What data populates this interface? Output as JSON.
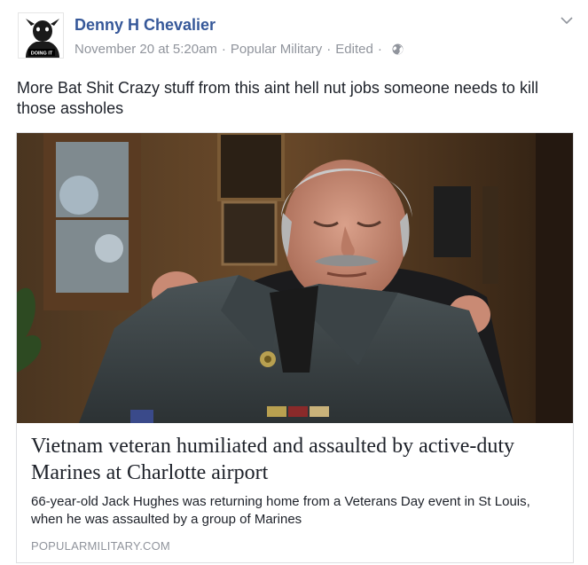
{
  "post": {
    "author": "Denny H Chevalier",
    "timestamp": "November 20 at 5:20am",
    "source": "Popular Military",
    "edited": "Edited",
    "separator": "·",
    "privacy_icon": "globe-icon",
    "menu_icon": "chevron-down-icon",
    "avatar_caption": "DOING IT",
    "text": "More Bat Shit Crazy stuff from this aint hell nut jobs someone needs to kill those assholes"
  },
  "link_card": {
    "title": "Vietnam veteran humiliated and assaulted by active-duty Marines at Charlotte airport",
    "description": "66-year-old Jack Hughes was returning home from a Veterans Day event in St Louis, when he was assaulted by a group of Marines",
    "domain": "POPULARMILITARY.COM"
  },
  "colors": {
    "author_link": "#365899",
    "meta_text": "#90949c",
    "body_text": "#1d2129",
    "card_border": "#dddfe2"
  }
}
